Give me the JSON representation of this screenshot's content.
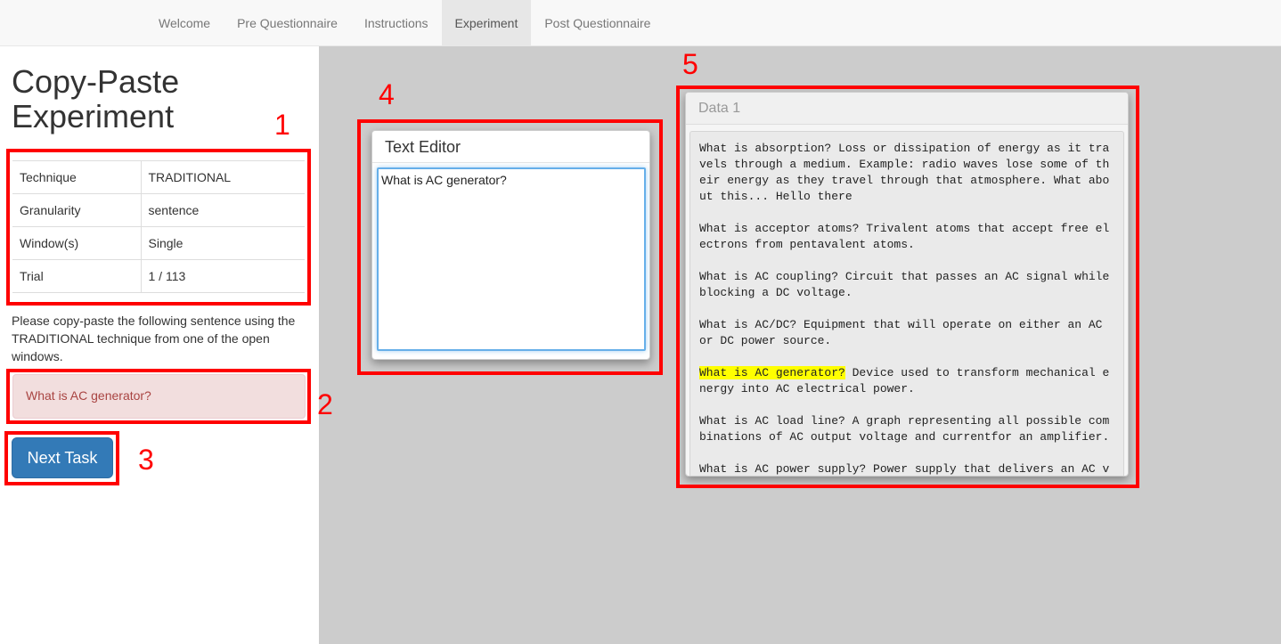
{
  "nav": {
    "tabs": [
      {
        "label": "Welcome"
      },
      {
        "label": "Pre Questionnaire"
      },
      {
        "label": "Instructions"
      },
      {
        "label": "Experiment"
      },
      {
        "label": "Post Questionnaire"
      }
    ],
    "active_index": 3
  },
  "page": {
    "title": "Copy-Paste Experiment"
  },
  "info_table": [
    {
      "key": "Technique",
      "value": "TRADITIONAL"
    },
    {
      "key": "Granularity",
      "value": "sentence"
    },
    {
      "key": "Window(s)",
      "value": "Single"
    },
    {
      "key": "Trial",
      "value": "1 / 113"
    }
  ],
  "instructions": "Please copy-paste the following sentence using the TRADITIONAL technique from one of the open windows.",
  "target_sentence": "What is AC generator?",
  "next_button_label": "Next Task",
  "editor": {
    "title": "Text Editor",
    "value": "What is AC generator?"
  },
  "data_window": {
    "title": "Data 1",
    "entries": [
      {
        "pre": "",
        "highlight": "",
        "text": "What is absorption? Loss or dissipation of energy as it travels through a medium. Example: radio waves lose some of their energy as they travel through that atmosphere. What about this... Hello there"
      },
      {
        "pre": "",
        "highlight": "",
        "text": "What is acceptor atoms? Trivalent atoms that accept free electrons from pentavalent atoms."
      },
      {
        "pre": "",
        "highlight": "",
        "text": "What is AC coupling? Circuit that passes an AC signal while blocking a DC voltage."
      },
      {
        "pre": "",
        "highlight": "",
        "text": "What is AC/DC? Equipment that will operate on either an AC  or DC power source."
      },
      {
        "pre": "",
        "highlight": "What is AC generator?",
        "text": " Device used to transform mechanical energy into AC electrical power."
      },
      {
        "pre": "",
        "highlight": "",
        "text": "What is AC load line? A graph representing all possible combinations of AC output voltage and currentfor an amplifier."
      },
      {
        "pre": "",
        "highlight": "",
        "text": "What is AC power supply? Power supply that delivers an AC voltage."
      }
    ]
  },
  "annotations": [
    "1",
    "2",
    "3",
    "4",
    "5"
  ],
  "colors": {
    "annotation": "#ff0000",
    "highlight": "#ffff00",
    "primary_button": "#337ab7",
    "alert_bg": "#f2dede",
    "alert_text": "#a94442",
    "workspace_bg": "#cccccc"
  }
}
